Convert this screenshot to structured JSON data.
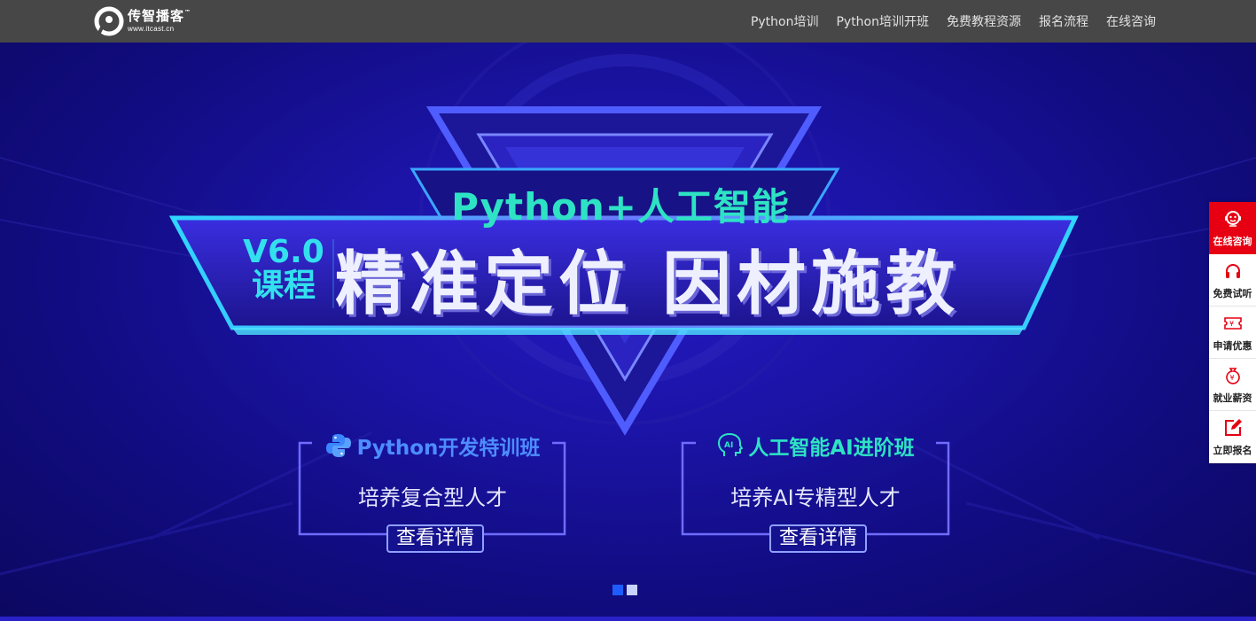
{
  "brand": {
    "name_cn": "传智播客",
    "tm": "™",
    "domain": "www.itcast.cn"
  },
  "nav": {
    "items": [
      {
        "label": "Python培训"
      },
      {
        "label": "Python培训开班"
      },
      {
        "label": "免费教程资源"
      },
      {
        "label": "报名流程"
      },
      {
        "label": "在线咨询"
      }
    ]
  },
  "hero": {
    "subtitle": "Python+人工智能",
    "version": "V6.0",
    "version_suffix": "课程",
    "title": "精准定位 因材施教",
    "cards": [
      {
        "title": "Python开发特训班",
        "desc": "培养复合型人才",
        "button": "查看详情",
        "icon": "python-icon"
      },
      {
        "title": "人工智能AI进阶班",
        "desc": "培养AI专精型人才",
        "button": "查看详情",
        "icon": "ai-head-icon"
      }
    ],
    "carousel": {
      "total": 2,
      "active": 1
    }
  },
  "sidebar": {
    "items": [
      {
        "label": "在线咨询",
        "icon": "customer-service-icon",
        "active": true
      },
      {
        "label": "免费试听",
        "icon": "headphones-icon",
        "active": false
      },
      {
        "label": "申请优惠",
        "icon": "coupon-icon",
        "active": false
      },
      {
        "label": "就业薪资",
        "icon": "money-bag-icon",
        "active": false
      },
      {
        "label": "立即报名",
        "icon": "edit-icon",
        "active": false
      }
    ]
  },
  "colors": {
    "topbar": "#474747",
    "hero_bg": "#1a13a3",
    "accent_teal": "#2de3c4",
    "accent_cyan": "#33e0ee",
    "sidebar_active": "#e60012",
    "sidebar_icon": "#e60012"
  }
}
